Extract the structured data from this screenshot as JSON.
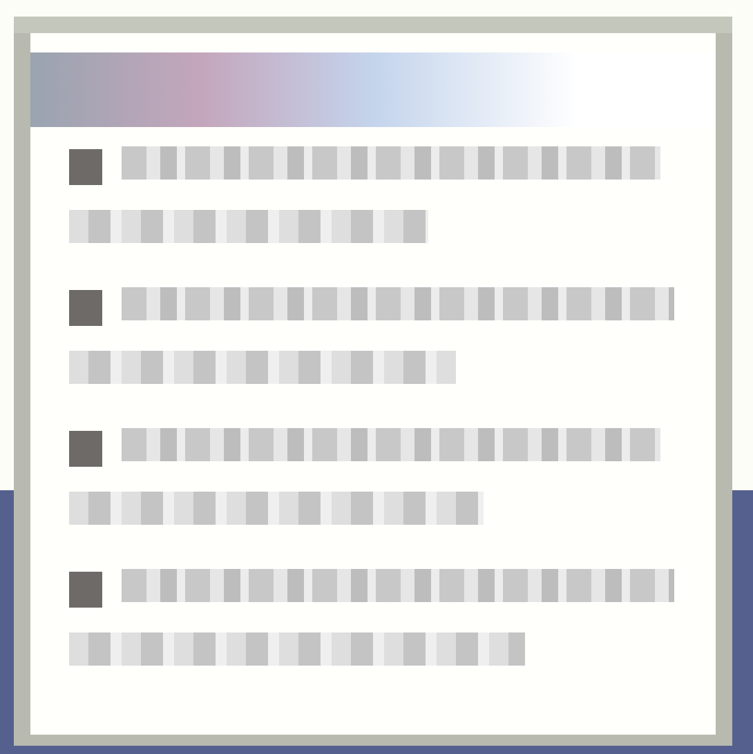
{
  "window": {
    "kind": "dialog"
  },
  "items": [
    {
      "kind": "bullet"
    },
    {
      "kind": "bullet"
    },
    {
      "kind": "bullet"
    },
    {
      "kind": "bullet"
    }
  ]
}
